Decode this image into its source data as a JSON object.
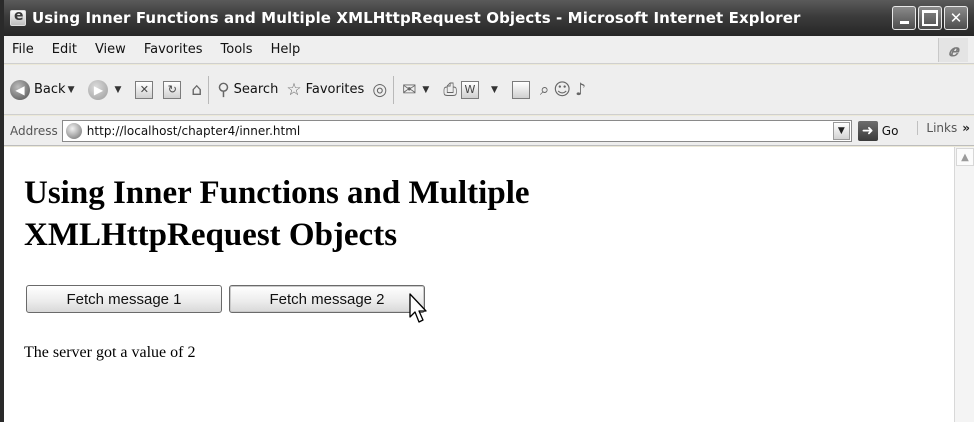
{
  "window": {
    "title": "Using Inner Functions and Multiple XMLHttpRequest Objects - Microsoft Internet Explorer",
    "caption_close": "✕"
  },
  "menubar": {
    "items": [
      "File",
      "Edit",
      "View",
      "Favorites",
      "Tools",
      "Help"
    ]
  },
  "toolbar": {
    "back_label": "Back",
    "search_label": "Search",
    "favorites_label": "Favorites"
  },
  "address": {
    "label": "Address",
    "url": "http://localhost/chapter4/inner.html",
    "go_label": "Go",
    "links_label": "Links",
    "links_chevron": "»"
  },
  "page": {
    "heading": "Using Inner Functions and Multiple XMLHttpRequest Objects",
    "button1_label": "Fetch message 1",
    "button2_label": "Fetch message 2",
    "result_text": "The server got a value of 2"
  },
  "icons": {
    "back": "arrow-left-icon",
    "forward": "arrow-right-icon",
    "stop": "stop-icon",
    "refresh": "refresh-icon",
    "home": "home-icon",
    "search": "search-icon",
    "favorites": "star-icon",
    "history": "history-icon",
    "mail": "mail-icon",
    "print": "printer-icon",
    "edit": "edit-icon",
    "discuss": "discuss-icon",
    "research": "research-icon",
    "messenger": "messenger-icon",
    "go": "go-arrow-icon"
  }
}
